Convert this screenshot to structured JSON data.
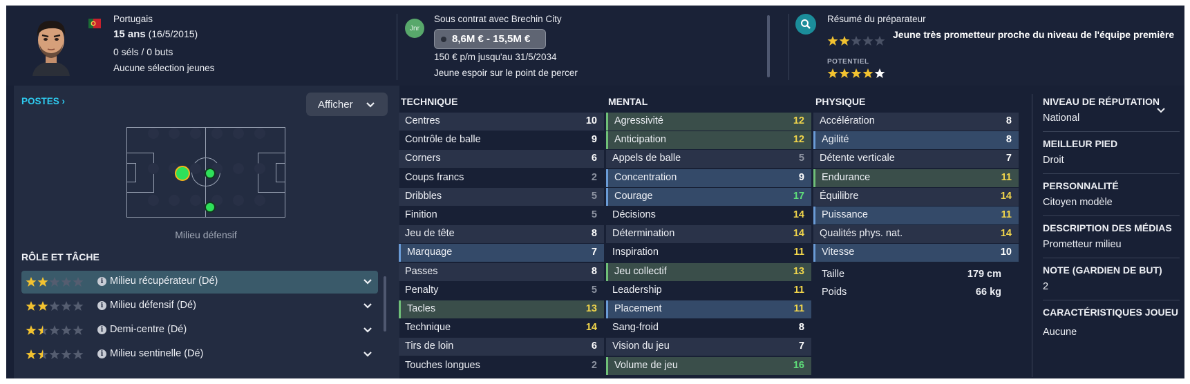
{
  "header": {
    "nationality": "Portugais",
    "age": "15 ans",
    "birthdate": "(16/5/2015)",
    "caps_goals": "0 séls / 0 buts",
    "youth_caps": "Aucune sélection jeunes",
    "contract_badge": "Jnr",
    "contract": "Sous contrat avec Brechin City",
    "value_range": "8,6M € - 15,5M €",
    "wage": "150 € p/m jusqu'au 31/5/2034",
    "contract_status": "Jeune espoir sur le point de percer",
    "coach_report_title": "Résumé du préparateur",
    "coach_report_text": "Jeune très prometteur proche du niveau de l'équipe première",
    "potential_label": "POTENTIEL",
    "ability_stars": 2,
    "potential_stars": 4.5
  },
  "positions": {
    "title": "POSTES",
    "show_button": "Afficher",
    "label": "Milieu défensif"
  },
  "roles": {
    "title": "RÔLE ET TÂCHE",
    "items": [
      {
        "label": "Milieu récupérateur (Dé)",
        "stars": 2
      },
      {
        "label": "Milieu défensif (Dé)",
        "stars": 2
      },
      {
        "label": "Demi-centre (Dé)",
        "stars": 1.5
      },
      {
        "label": "Milieu sentinelle (Dé)",
        "stars": 1.5
      }
    ]
  },
  "technique": {
    "title": "TECHNIQUE",
    "items": [
      {
        "name": "Centres",
        "value": "10"
      },
      {
        "name": "Contrôle de balle",
        "value": "9"
      },
      {
        "name": "Corners",
        "value": "6"
      },
      {
        "name": "Coups francs",
        "value": "2"
      },
      {
        "name": "Dribbles",
        "value": "5"
      },
      {
        "name": "Finition",
        "value": "5"
      },
      {
        "name": "Jeu de tête",
        "value": "8"
      },
      {
        "name": "Marquage",
        "value": "7"
      },
      {
        "name": "Passes",
        "value": "8"
      },
      {
        "name": "Penalty",
        "value": "5"
      },
      {
        "name": "Tacles",
        "value": "13"
      },
      {
        "name": "Technique",
        "value": "14"
      },
      {
        "name": "Tirs de loin",
        "value": "6"
      },
      {
        "name": "Touches longues",
        "value": "2"
      }
    ]
  },
  "mental": {
    "title": "MENTAL",
    "items": [
      {
        "name": "Agressivité",
        "value": "12"
      },
      {
        "name": "Anticipation",
        "value": "12"
      },
      {
        "name": "Appels de balle",
        "value": "5"
      },
      {
        "name": "Concentration",
        "value": "9"
      },
      {
        "name": "Courage",
        "value": "17"
      },
      {
        "name": "Décisions",
        "value": "14"
      },
      {
        "name": "Détermination",
        "value": "14"
      },
      {
        "name": "Inspiration",
        "value": "11"
      },
      {
        "name": "Jeu collectif",
        "value": "13"
      },
      {
        "name": "Leadership",
        "value": "11"
      },
      {
        "name": "Placement",
        "value": "11"
      },
      {
        "name": "Sang-froid",
        "value": "8"
      },
      {
        "name": "Vision du jeu",
        "value": "7"
      },
      {
        "name": "Volume de jeu",
        "value": "16"
      }
    ]
  },
  "physique": {
    "title": "PHYSIQUE",
    "items": [
      {
        "name": "Accélération",
        "value": "8"
      },
      {
        "name": "Agilité",
        "value": "8"
      },
      {
        "name": "Détente verticale",
        "value": "7"
      },
      {
        "name": "Endurance",
        "value": "11"
      },
      {
        "name": "Équilibre",
        "value": "14"
      },
      {
        "name": "Puissance",
        "value": "11"
      },
      {
        "name": "Qualités phys. nat.",
        "value": "14"
      },
      {
        "name": "Vitesse",
        "value": "10"
      }
    ],
    "height_label": "Taille",
    "height": "179 cm",
    "weight_label": "Poids",
    "weight": "66 kg"
  },
  "info": {
    "reputation_label": "NIVEAU DE RÉPUTATION",
    "reputation": "National",
    "foot_label": "MEILLEUR PIED",
    "foot": "Droit",
    "personality_label": "PERSONNALITÉ",
    "personality": "Citoyen modèle",
    "media_label": "DESCRIPTION DES MÉDIAS",
    "media": "Prometteur milieu",
    "gk_label": "NOTE (GARDIEN DE BUT)",
    "gk": "2",
    "traits_label": "CARACTÉRISTIQUES JOUEU",
    "traits": "Aucune"
  },
  "colors": {
    "star_gold": "#f2c230",
    "star_empty": "#4a5266",
    "highlight_blue": "#344a69",
    "highlight_green": "#3a4e4a",
    "accent_cyan": "#2ecbf0"
  }
}
